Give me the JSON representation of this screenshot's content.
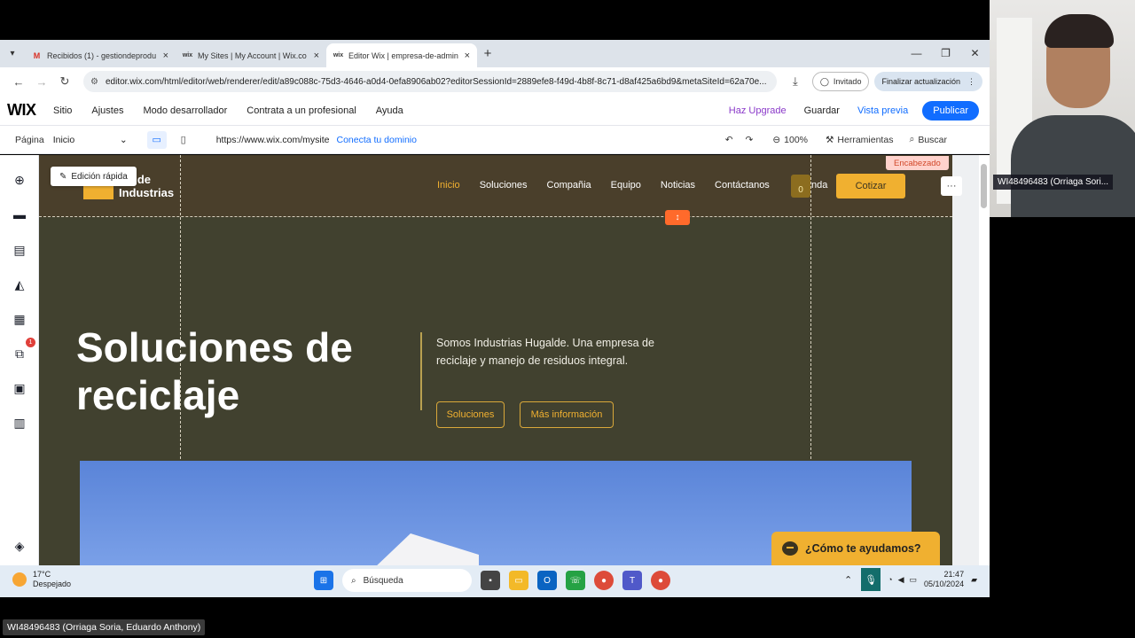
{
  "browser": {
    "tabs": [
      {
        "icon": "gmail-icon",
        "title": "Recibidos (1) - gestiondeprodu"
      },
      {
        "icon": "wix-icon",
        "title": "My Sites | My Account | Wix.co"
      },
      {
        "icon": "wix-icon",
        "title": "Editor Wix | empresa-de-admin"
      }
    ],
    "url": "editor.wix.com/html/editor/web/renderer/edit/a89c088c-75d3-4646-a0d4-0efa8906ab02?editorSessionId=2889efe8-f49d-4b8f-8c71-d8af425a6bd9&metaSiteId=62a70e...",
    "profile_label": "Invitado",
    "update_label": "Finalizar actualización"
  },
  "wix_top": {
    "logo": "WIX",
    "menu": [
      "Sitio",
      "Ajustes",
      "Modo desarrollador",
      "Contrata a un profesional",
      "Ayuda"
    ],
    "upgrade": "Haz Upgrade",
    "save": "Guardar",
    "preview": "Vista previa",
    "publish": "Publicar"
  },
  "wix_second": {
    "page_label": "Página",
    "page_value": "Inicio",
    "site_url": "https://www.wix.com/mysite",
    "domain_link": "Conecta tu dominio",
    "zoom": "100%",
    "tools": "Herramientas",
    "search": "Buscar"
  },
  "rail_badge": "1",
  "site": {
    "quick_edit": "Edición rápida",
    "logo_text": [
      "alde",
      "Industrias"
    ],
    "nav": [
      "Inicio",
      "Soluciones",
      "Compañia",
      "Equipo",
      "Noticias",
      "Contáctanos"
    ],
    "cart_count": "0",
    "tienda": "nda",
    "cta": "Cotizar",
    "section_tag": "Encabezado",
    "hero_title": "Soluciones de reciclaje",
    "hero_text": "Somos Industrias Hugalde. Una empresa de reciclaje y manejo de residuos integral.",
    "btn1": "Soluciones",
    "btn2": "Más información",
    "help": "¿Cómo te ayudamos?"
  },
  "taskbar": {
    "temp": "17°C",
    "weather": "Despejado",
    "search": "Búsqueda",
    "time": "21:47",
    "date": "05/10/2024"
  },
  "webcam_label": "WI48496483 (Orriaga Sori...",
  "bottom_label": "WI48496483 (Orriaga Soria, Eduardo Anthony)"
}
